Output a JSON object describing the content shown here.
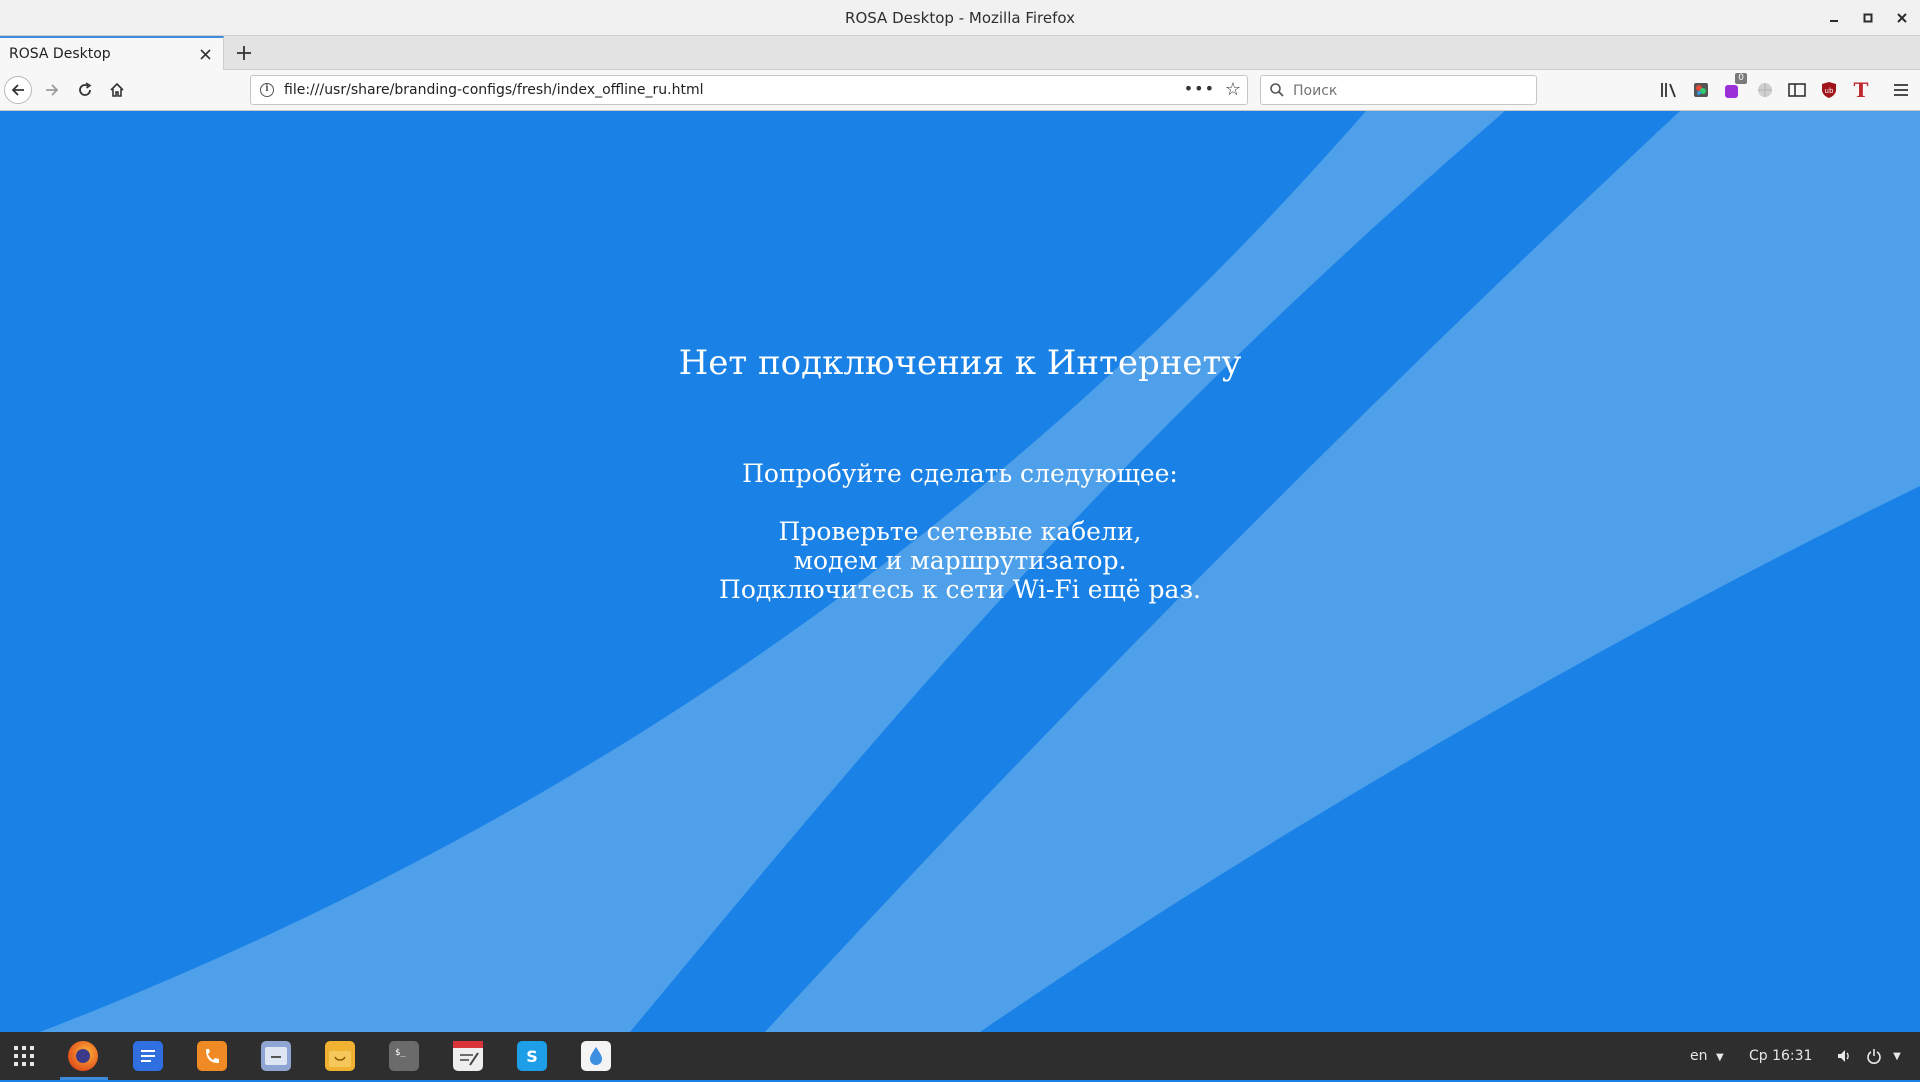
{
  "window": {
    "title": "ROSA Desktop - Mozilla Firefox"
  },
  "tabs": [
    {
      "label": "ROSA Desktop",
      "active": true
    }
  ],
  "navbar": {
    "url": "file:///usr/share/branding-configs/fresh/index_offline_ru.html",
    "search_placeholder": "Поиск",
    "addon_badge_count": "0"
  },
  "page": {
    "heading": "Нет подключения к Интернету",
    "subheading": "Попробуйте сделать следующее:",
    "lines": [
      "Проверьте сетевые кабели,",
      "модем и маршрутизатор.",
      "Подключитесь к сети Wi-Fi ещё раз."
    ],
    "colors": {
      "background": "#1a82e6",
      "stripe": "#4fa0ea"
    }
  },
  "taskbar": {
    "apps": [
      "apps-grid-icon",
      "firefox-icon",
      "docs-icon",
      "dialer-icon",
      "files-icon",
      "store-icon",
      "terminal-icon",
      "notes-icon",
      "skype-icon",
      "drop-icon"
    ],
    "keyboard_layout": "en",
    "clock": "Ср 16:31"
  }
}
